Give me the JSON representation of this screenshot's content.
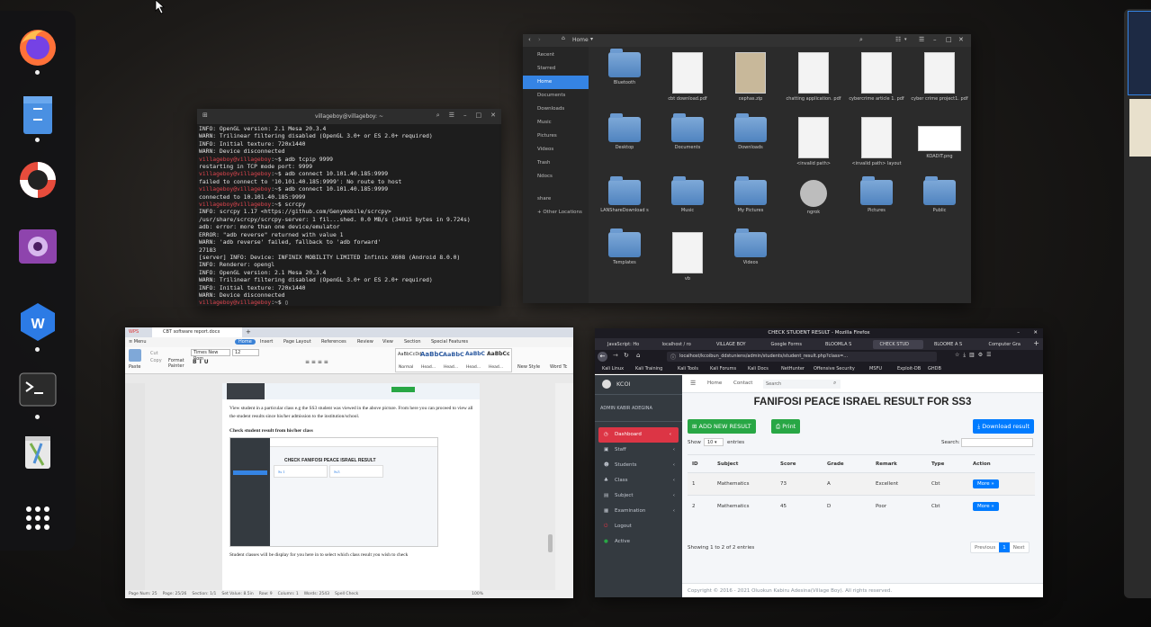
{
  "dock": {
    "apps": [
      "firefox",
      "files",
      "help",
      "video-player",
      "wps-office",
      "terminal",
      "trash",
      "show-applications"
    ]
  },
  "terminal": {
    "title": "villageboy@villageboy: ~",
    "lines": [
      {
        "t": "INFO: OpenGL version: 2.1 Mesa 20.3.4"
      },
      {
        "t": "WARN: Trilinear filtering disabled (OpenGL 3.0+ or ES 2.0+ required)"
      },
      {
        "t": "INFO: Initial texture: 720x1440"
      },
      {
        "t": "WARN: Device disconnected"
      },
      {
        "p": "villageboy@villageboy",
        "t": ":~$ adb tcpip 9999"
      },
      {
        "t": "restarting in TCP mode port: 9999"
      },
      {
        "p": "villageboy@villageboy",
        "t": ":~$ adb connect 10.101.40.185:9999"
      },
      {
        "t": "failed to connect to '10.101.40.185:9999': No route to host"
      },
      {
        "p": "villageboy@villageboy",
        "t": ":~$ adb connect 10.101.40.185:9999"
      },
      {
        "t": "connected to 10.101.40.185:9999"
      },
      {
        "p": "villageboy@villageboy",
        "t": ":~$ scrcpy"
      },
      {
        "t": "INFO: scrcpy 1.17 <https://github.com/Genymobile/scrcpy>"
      },
      {
        "t": "/usr/share/scrcpy/scrcpy-server: 1 fil...shed. 0.0 MB/s (34015 bytes in 9.724s)"
      },
      {
        "t": "adb: error: more than one device/emulator"
      },
      {
        "t": "ERROR: \"adb reverse\" returned with value 1"
      },
      {
        "t": "WARN: 'adb reverse' failed, fallback to 'adb forward'"
      },
      {
        "t": "27183"
      },
      {
        "t": "[server] INFO: Device: INFINIX MOBILITY LIMITED Infinix X608 (Android 8.0.0)"
      },
      {
        "t": "INFO: Renderer: opengl"
      },
      {
        "t": "INFO: OpenGL version: 2.1 Mesa 20.3.4"
      },
      {
        "t": "WARN: Trilinear filtering disabled (OpenGL 3.0+ or ES 2.0+ required)"
      },
      {
        "t": "INFO: Initial texture: 720x1440"
      },
      {
        "t": "WARN: Device disconnected"
      },
      {
        "p": "villageboy@villageboy",
        "t": ":~$ "
      }
    ]
  },
  "files": {
    "path": "Home",
    "sidebar": [
      "Recent",
      "Starred",
      "Home",
      "Documents",
      "Downloads",
      "Music",
      "Pictures",
      "Videos",
      "Trash",
      "Ndocs",
      "share",
      "+ Other Locations"
    ],
    "items": [
      {
        "label": "Bluetooth",
        "kind": "folder"
      },
      {
        "label": "cbt download.pdf",
        "kind": "doc"
      },
      {
        "label": "cephas.zip",
        "kind": "zip"
      },
      {
        "label": "chatting application. pdf",
        "kind": "doc"
      },
      {
        "label": "cybercrime article 1. pdf",
        "kind": "doc"
      },
      {
        "label": "cyber crime project1. pdf",
        "kind": "doc"
      },
      {
        "label": "Desktop",
        "kind": "folder"
      },
      {
        "label": "Documents",
        "kind": "folder"
      },
      {
        "label": "Downloads",
        "kind": "folder"
      },
      {
        "label": "<invalid path>",
        "kind": "doc"
      },
      {
        "label": "<invalid path> layout",
        "kind": "doc"
      },
      {
        "label": "KOADIT.png",
        "kind": "img"
      },
      {
        "label": "LANShareDownload s",
        "kind": "folder"
      },
      {
        "label": "Music",
        "kind": "folder"
      },
      {
        "label": "My Pictures",
        "kind": "folder"
      },
      {
        "label": "ngrok",
        "kind": "gear"
      },
      {
        "label": "Pictures",
        "kind": "folder"
      },
      {
        "label": "Public",
        "kind": "folder"
      },
      {
        "label": "Templates",
        "kind": "folder"
      },
      {
        "label": "vb",
        "kind": "doc"
      },
      {
        "label": "Videos",
        "kind": "folder"
      }
    ]
  },
  "wps": {
    "tabs": [
      "WPS",
      "CBT software report.docx"
    ],
    "menu": [
      "≡ Menu",
      "Home",
      "Insert",
      "Page Layout",
      "References",
      "Review",
      "View",
      "Section",
      "Special Features"
    ],
    "ribbon": [
      "Paste",
      "Cut",
      "Copy",
      "Format Painter",
      "Times New Rom",
      "12",
      "Normal",
      "Head...",
      "Head...",
      "Head...",
      "Head...",
      "New Style",
      "Word Tc"
    ],
    "styles_preview": [
      "AaBbCcDd",
      "AaBbC",
      "AaBbC",
      "AaBbC",
      "AaBbCc"
    ],
    "para1": "View student in a particular class e.g the SS3 student was viewed in the above picture. From here you can proceed to view all the student results since his/her admission to the institution/school.",
    "heading": "Check student result from his/her class",
    "embedded_title": "CHECK FANIFOSI PEACE ISRAEL RESULT",
    "embedded_cells": [
      "Ss 1",
      "Ss3"
    ],
    "para2": "Student classes will be display for you here in to select which class result you wish to check",
    "status": [
      "Page Num: 25",
      "Page: 25/26",
      "Section: 1/1",
      "Set Value: 8.5in",
      "Row: 9",
      "Column: 1",
      "Words: 2543",
      "Spell Check"
    ],
    "zoom": "100%"
  },
  "firefox": {
    "window_title": "CHECK STUDENT RESULT - Mozilla Firefox",
    "tabs": [
      "JavaScript: Ho",
      "localhost / ro",
      "VILLAGE BOY",
      "Google Forms",
      "BLOOMLA S",
      "CHECK STUD",
      "BLOOME A S",
      "Computer Gra"
    ],
    "url": "localhost/kcoibun_ddstuniens/admin/students/student_result.php?class=...",
    "bookmarks": [
      "Kali Linux",
      "Kali Training",
      "Kali Tools",
      "Kali Forums",
      "Kali Docs",
      "NetHunter",
      "Offensive Security",
      "MSFU",
      "Exploit-DB",
      "GHDB"
    ],
    "brand": "KCOI",
    "admin": "ADMIN KABIR ADEGINA",
    "topnav": [
      "Home",
      "Contact"
    ],
    "search_placeholder": "Search",
    "menu": [
      "Dashboard",
      "Staff",
      "Students",
      "Class",
      "Subject",
      "Examination",
      "Logout",
      "Active"
    ],
    "heading": "FANIFOSI PEACE ISRAEL RESULT FOR SS3",
    "add_btn": "ADD NEW RESULT",
    "print_btn": "Print",
    "download_btn": "Download result",
    "show_label": "Show",
    "show_value": "10",
    "entries_label": "entries",
    "search_label": "Search:",
    "columns": [
      "ID",
      "Subject",
      "Score",
      "Grade",
      "Remark",
      "Type",
      "Action"
    ],
    "rows": [
      [
        "1",
        "Mathematics",
        "73",
        "A",
        "Excellent",
        "Cbt",
        "More »"
      ],
      [
        "2",
        "Mathematics",
        "45",
        "D",
        "Poor",
        "Cbt",
        "More »"
      ]
    ],
    "info": "Showing 1 to 2 of 2 entries",
    "pager": [
      "Previous",
      "1",
      "Next"
    ],
    "footer": "Copyright © 2016 - 2021 Oluokun Kabiru Adesina(Village Boy). All rights reserved."
  }
}
